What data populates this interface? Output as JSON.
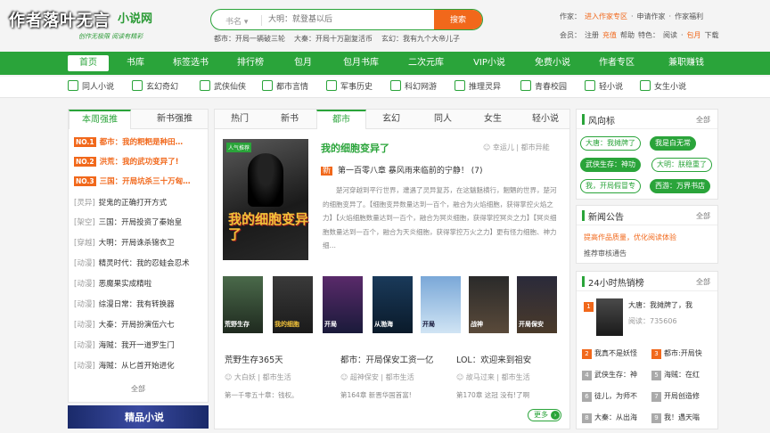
{
  "watermark": "作者落叶无言",
  "logo": {
    "name": "小说网",
    "slogan": "创作无极限 阅读有精彩"
  },
  "search": {
    "category": "书名",
    "placeholder": "大明：就登基以后",
    "button": "搜索"
  },
  "hot_searches": [
    "都市：开局一辆破三轮",
    "大秦：开局十万副复活币",
    "玄幻：我有九个大帝儿子"
  ],
  "top_right": {
    "row1": [
      "作家：",
      "进入作家专区",
      "·",
      "申请作家",
      "·",
      "作家福利"
    ],
    "row2": [
      "会员：",
      "注册",
      "充值",
      "帮助",
      "特色：",
      "阅读",
      "·",
      "包月",
      "下载"
    ]
  },
  "nav": [
    "首页",
    "书库",
    "标签选书",
    "排行榜",
    "包月",
    "包月书库",
    "二次元库",
    "VIP小说",
    "免费小说",
    "作者专区",
    "兼职赚钱"
  ],
  "categories": [
    "同人小说",
    "玄幻奇幻",
    "武侠仙侠",
    "都市言情",
    "军事历史",
    "科幻网游",
    "推理灵异",
    "青春校园",
    "轻小说",
    "女生小说"
  ],
  "left": {
    "tabs": [
      "本周强推",
      "新书强推"
    ],
    "top": [
      {
        "no": "NO.1",
        "text": "都市：我的粑粑是种田…"
      },
      {
        "no": "NO.2",
        "text": "洪荒：我的武功变异了!"
      },
      {
        "no": "NO.3",
        "text": "三国：开局坑杀三十万匈…"
      }
    ],
    "items": [
      {
        "g": "[灵异]",
        "t": "捉鬼的正确打开方式"
      },
      {
        "g": "[架空]",
        "t": "三国：开局投资了秦始皇"
      },
      {
        "g": "[穿越]",
        "t": "大明：开局诛杀锦衣卫"
      },
      {
        "g": "[动漫]",
        "t": "精灵时代：我的忍蛙会忍术"
      },
      {
        "g": "[动漫]",
        "t": "恶魔果实成精啦"
      },
      {
        "g": "[动漫]",
        "t": "综漫日常：我有转换器"
      },
      {
        "g": "[动漫]",
        "t": "大秦：开局扮演伍六七"
      },
      {
        "g": "[动漫]",
        "t": "海贼：我开一道罗生门"
      },
      {
        "g": "[动漫]",
        "t": "海贼：从匕首开始进化"
      }
    ],
    "more": "全部",
    "banner": "精品小说"
  },
  "center": {
    "tabs": [
      "热门",
      "新书",
      "都市",
      "玄幻",
      "同人",
      "女生",
      "轻小说"
    ],
    "cover_tag": "人气推荐",
    "cover_title": "我的细胞变异了",
    "title": "我的细胞变异了",
    "author": "幸运儿 | 都市异能",
    "chapter_tag": "新",
    "chapter": "第一百零八章 暴风雨来临前的宁静！ (7)",
    "desc": "　　楚河穿越到平行世界，遭遇了灵异复苏，在这魑魅横行，魍魉的世界，楚河的细胞变异了。【细胞变异数量达到一百个，融合为火焰细胞，获得掌控火焰之力】【火焰细胞数量达到一百个，融合为冥炎细胞，获得掌控冥炎之力】【冥炎细胞数量达到一百个，融合为天炎细胞，获得掌控万火之力】更有怪力细胞、神力细…",
    "covers": [
      "荒野生存",
      "我的细胞",
      "开局",
      "从渤海",
      "开局",
      "战神",
      "开局保安"
    ],
    "books": [
      {
        "t": "荒野生存365天",
        "a": "大白妖 | 都市生活",
        "c": "第一千零五十章：钱权。"
      },
      {
        "t": "都市：开局保安工资一亿",
        "a": "超神保安 | 都市生活",
        "c": "第164章 新晋华国首富!"
      },
      {
        "t": "LOL：欢迎来到祖安",
        "a": "故马过来 | 都市生活",
        "c": "第170章 这冠 没有!了啊"
      }
    ],
    "more": "更多"
  },
  "right": {
    "wind": {
      "title": "风向标",
      "all": "全部",
      "pills": [
        "大唐：我摊牌了",
        "我是白无常",
        "武侠生存：神功",
        "大明：朕稳重了",
        "我，开局假冒专",
        "西游：万界书店"
      ]
    },
    "news": {
      "title": "新闻公告",
      "all": "全部",
      "items": [
        "提高作品质量，优化阅读体验",
        "推荐审核通告"
      ]
    },
    "rank": {
      "title": "24小时热销榜",
      "all": "全部",
      "first_title": "大唐：我摊牌了，我",
      "first_count": "阅读：735606",
      "rows": [
        [
          "2",
          "我真不是妖怪",
          "3",
          "都市:开局快"
        ],
        [
          "4",
          "武侠生存：神",
          "5",
          "海贼：在红"
        ],
        [
          "6",
          "徒儿，为师不",
          "7",
          "开局创造修"
        ],
        [
          "8",
          "大秦：从出海",
          "9",
          "我！遇天嗡"
        ]
      ]
    }
  },
  "colors": {
    "accent": "#2aa43a",
    "orange": "#f1681b"
  }
}
